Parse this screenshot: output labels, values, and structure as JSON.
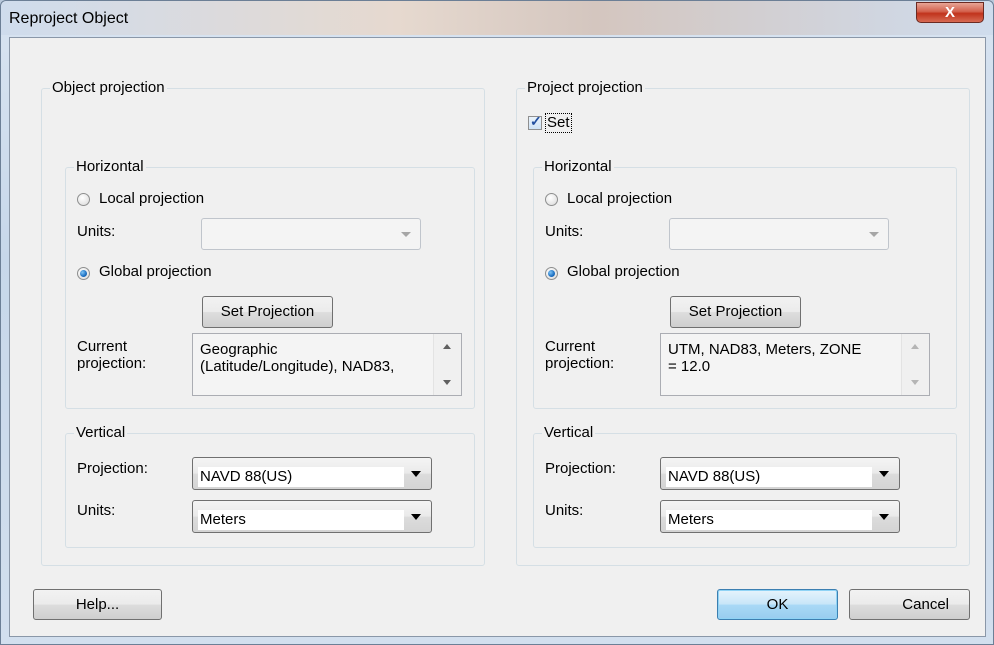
{
  "window": {
    "title": "Reproject Object",
    "close_label": "X"
  },
  "object_projection": {
    "group_label": "Object projection",
    "horizontal": {
      "group_label": "Horizontal",
      "local_label": "Local projection",
      "units_label": "Units:",
      "units_value": "",
      "global_label": "Global projection",
      "global_selected": true,
      "set_projection_label": "Set Projection",
      "current_label_1": "Current",
      "current_label_2": "projection:",
      "current_value_1": "Geographic",
      "current_value_2": "(Latitude/Longitude), NAD83,"
    },
    "vertical": {
      "group_label": "Vertical",
      "projection_label": "Projection:",
      "projection_value": "NAVD 88(US)",
      "units_label": "Units:",
      "units_value": "Meters"
    }
  },
  "project_projection": {
    "group_label": "Project projection",
    "set_label": "Set",
    "set_checked": true,
    "horizontal": {
      "group_label": "Horizontal",
      "local_label": "Local projection",
      "units_label": "Units:",
      "units_value": "",
      "global_label": "Global projection",
      "global_selected": true,
      "set_projection_label": "Set Projection",
      "current_label_1": "Current",
      "current_label_2": "projection:",
      "current_value_1": "UTM, NAD83, Meters, ZONE",
      "current_value_2": "= 12.0"
    },
    "vertical": {
      "group_label": "Vertical",
      "projection_label": "Projection:",
      "projection_value": "NAVD 88(US)",
      "units_label": "Units:",
      "units_value": "Meters"
    }
  },
  "buttons": {
    "help": "Help...",
    "ok": "OK",
    "cancel": "Cancel"
  },
  "icons": {
    "close": "close-icon",
    "dropdown": "chevron-down-icon",
    "scroll_up": "scroll-up-icon",
    "scroll_down": "scroll-down-icon",
    "check": "check-icon"
  }
}
